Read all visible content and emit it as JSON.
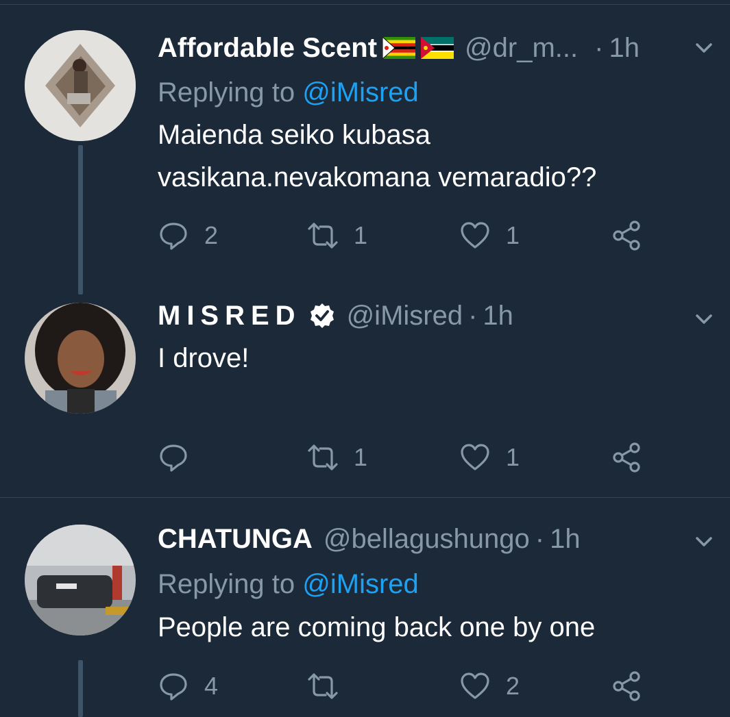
{
  "tweets": [
    {
      "name": "Affordable Scent",
      "flags": [
        "zimbabwe-flag",
        "mozambique-flag"
      ],
      "handle": "@dr_m...",
      "dot": "·",
      "time": "1h",
      "replying_prefix": "Replying to",
      "replying_to": "@iMisred",
      "text_lines": [
        "Maienda seiko kubasa",
        "vasikana.nevakomana vemaradio??"
      ],
      "reply_count": "2",
      "retweet_count": "1",
      "like_count": "1"
    },
    {
      "name": "MISRED",
      "verified": true,
      "handle": "@iMisred",
      "dot": "·",
      "time": "1h",
      "text_lines": [
        "I drove!"
      ],
      "reply_count": "",
      "retweet_count": "1",
      "like_count": "1"
    },
    {
      "name": "CHATUNGA",
      "handle": "@bellagushungo",
      "dot": "·",
      "time": "1h",
      "replying_prefix": "Replying to",
      "replying_to": "@iMisred",
      "text_lines": [
        "People are coming back one by one"
      ],
      "reply_count": "4",
      "retweet_count": "",
      "like_count": "2"
    }
  ],
  "colors": {
    "background": "#1c2938",
    "secondary_text": "#8899a6",
    "link": "#1da1f2",
    "divider": "#38444d"
  },
  "icons": [
    "reply-icon",
    "retweet-icon",
    "like-icon",
    "share-icon",
    "chevron-down-icon",
    "verified-icon"
  ]
}
